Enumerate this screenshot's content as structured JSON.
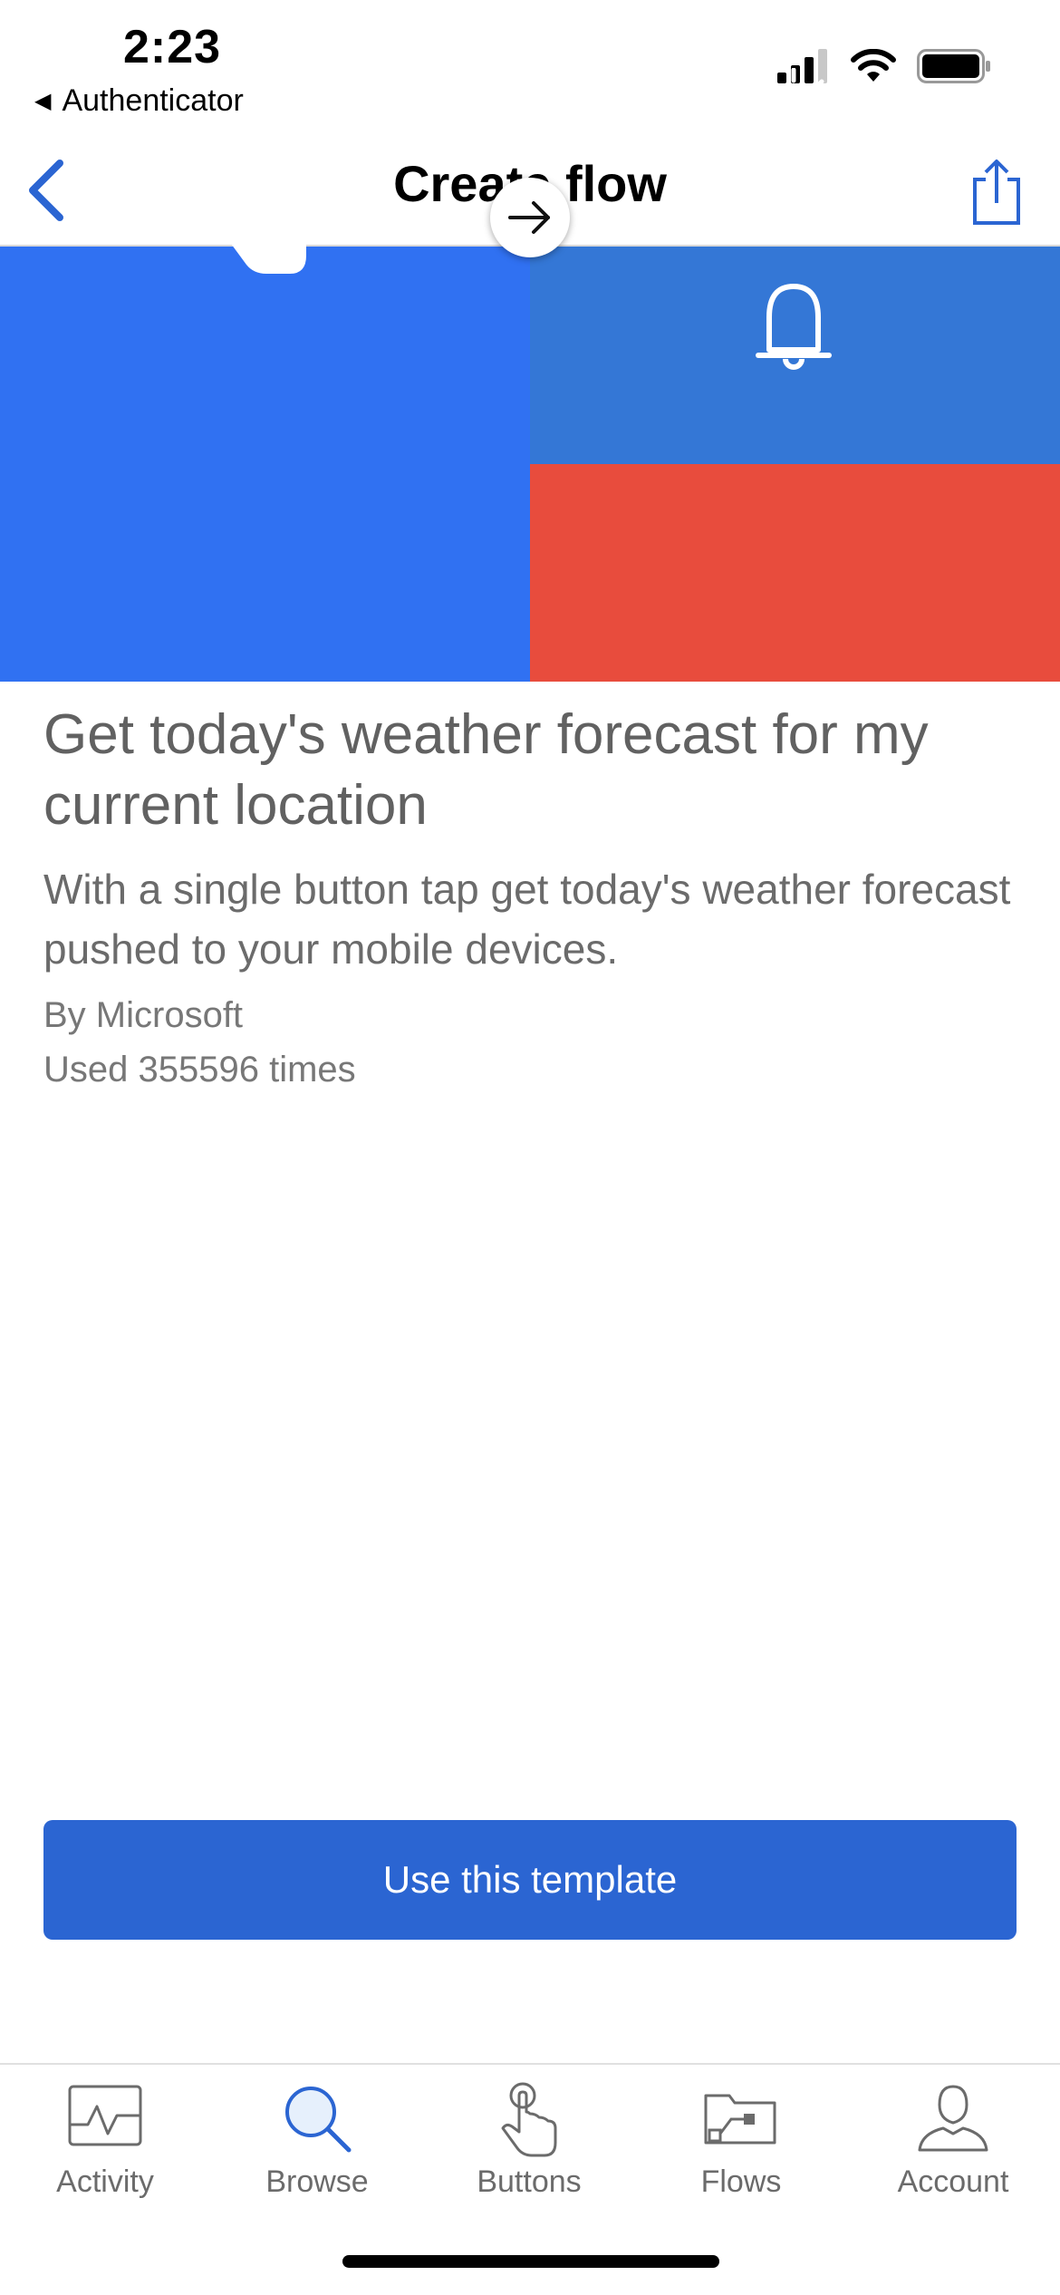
{
  "status_bar": {
    "time": "2:23",
    "back_app": "Authenticator",
    "icons": [
      "cellular-signal-icon",
      "wifi-icon",
      "battery-icon"
    ]
  },
  "nav_bar": {
    "title": "Create flow",
    "back_icon": "chevron-left-icon",
    "share_icon": "share-icon",
    "accent": "#2b65d2"
  },
  "hero": {
    "trigger_icon": "touch-button-icon",
    "connector_icon": "arrow-right-icon",
    "action_icons": [
      "weather-sun-icon",
      "notification-bell-icon"
    ],
    "colors": {
      "trigger": "#3071f2",
      "weather": "#3477d6",
      "notification": "#e84c3d"
    }
  },
  "template": {
    "title": "Get today's weather forecast for my current location",
    "description": "With a single button tap get today's weather forecast pushed to your mobile devices.",
    "author": "By Microsoft",
    "usage": "Used 355596 times"
  },
  "cta": {
    "label": "Use this template",
    "color": "#2b65d2"
  },
  "tabs": [
    {
      "label": "Activity",
      "icon": "activity-icon",
      "active": false
    },
    {
      "label": "Browse",
      "icon": "search-icon",
      "active": true
    },
    {
      "label": "Buttons",
      "icon": "touch-button-icon",
      "active": false
    },
    {
      "label": "Flows",
      "icon": "flows-folder-icon",
      "active": false
    },
    {
      "label": "Account",
      "icon": "account-icon",
      "active": false
    }
  ]
}
